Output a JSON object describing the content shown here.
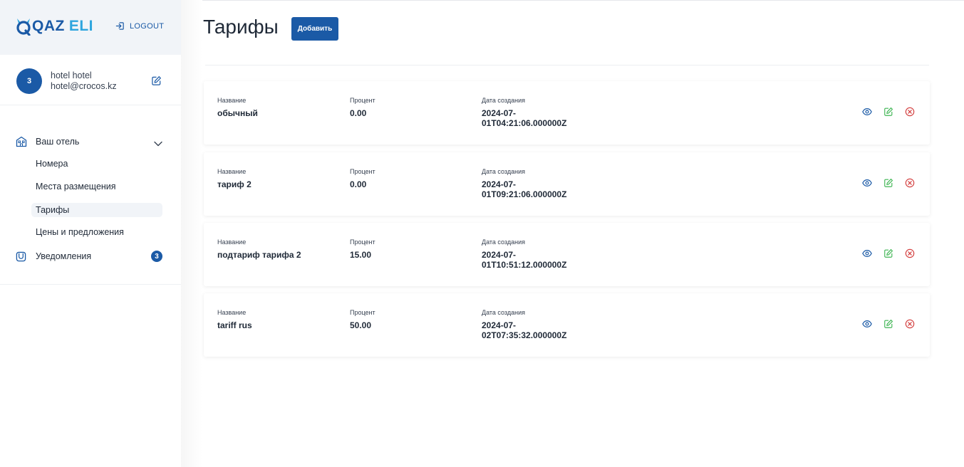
{
  "brand": {
    "logo_part1": "QAZ",
    "logo_part2": "ELI"
  },
  "header": {
    "logout_label": "LOGOUT"
  },
  "user": {
    "avatar_text": "3",
    "name": "hotel hotel",
    "email": "hotel@crocos.kz"
  },
  "sidebar": {
    "group_label": "Ваш отель",
    "items": [
      {
        "label": "Номера"
      },
      {
        "label": "Места размещения"
      },
      {
        "label": "Тарифы"
      },
      {
        "label": "Цены и предложения"
      }
    ],
    "notifications_label": "Уведомления",
    "notifications_count": "3"
  },
  "page": {
    "title": "Тарифы",
    "add_label": "Добавить"
  },
  "columns": {
    "name": "Название",
    "percent": "Процент",
    "created": "Дата создания"
  },
  "tariffs": [
    {
      "name": "обычный",
      "percent": "0.00",
      "created_line1": "2024-07-",
      "created_line2": "01T04:21:06.000000Z"
    },
    {
      "name": "тариф 2",
      "percent": "0.00",
      "created_line1": "2024-07-",
      "created_line2": "01T09:21:06.000000Z"
    },
    {
      "name": "подтариф тарифа 2",
      "percent": "15.00",
      "created_line1": "2024-07-",
      "created_line2": "01T10:51:12.000000Z"
    },
    {
      "name": "tariff rus",
      "percent": "50.00",
      "created_line1": "2024-07-",
      "created_line2": "02T07:35:32.000000Z"
    }
  ],
  "colors": {
    "primary": "#1b5aa6",
    "accent": "#2ea5de",
    "edit": "#3fb553",
    "delete": "#d23b3b"
  }
}
